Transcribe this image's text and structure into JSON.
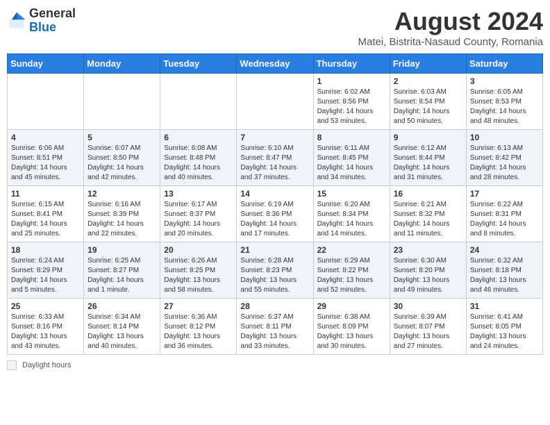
{
  "logo": {
    "general": "General",
    "blue": "Blue"
  },
  "title": "August 2024",
  "subtitle": "Matei, Bistrita-Nasaud County, Romania",
  "days_of_week": [
    "Sunday",
    "Monday",
    "Tuesday",
    "Wednesday",
    "Thursday",
    "Friday",
    "Saturday"
  ],
  "weeks": [
    [
      {
        "day": "",
        "info": ""
      },
      {
        "day": "",
        "info": ""
      },
      {
        "day": "",
        "info": ""
      },
      {
        "day": "",
        "info": ""
      },
      {
        "day": "1",
        "info": "Sunrise: 6:02 AM\nSunset: 8:56 PM\nDaylight: 14 hours\nand 53 minutes."
      },
      {
        "day": "2",
        "info": "Sunrise: 6:03 AM\nSunset: 8:54 PM\nDaylight: 14 hours\nand 50 minutes."
      },
      {
        "day": "3",
        "info": "Sunrise: 6:05 AM\nSunset: 8:53 PM\nDaylight: 14 hours\nand 48 minutes."
      }
    ],
    [
      {
        "day": "4",
        "info": "Sunrise: 6:06 AM\nSunset: 8:51 PM\nDaylight: 14 hours\nand 45 minutes."
      },
      {
        "day": "5",
        "info": "Sunrise: 6:07 AM\nSunset: 8:50 PM\nDaylight: 14 hours\nand 42 minutes."
      },
      {
        "day": "6",
        "info": "Sunrise: 6:08 AM\nSunset: 8:48 PM\nDaylight: 14 hours\nand 40 minutes."
      },
      {
        "day": "7",
        "info": "Sunrise: 6:10 AM\nSunset: 8:47 PM\nDaylight: 14 hours\nand 37 minutes."
      },
      {
        "day": "8",
        "info": "Sunrise: 6:11 AM\nSunset: 8:45 PM\nDaylight: 14 hours\nand 34 minutes."
      },
      {
        "day": "9",
        "info": "Sunrise: 6:12 AM\nSunset: 8:44 PM\nDaylight: 14 hours\nand 31 minutes."
      },
      {
        "day": "10",
        "info": "Sunrise: 6:13 AM\nSunset: 8:42 PM\nDaylight: 14 hours\nand 28 minutes."
      }
    ],
    [
      {
        "day": "11",
        "info": "Sunrise: 6:15 AM\nSunset: 8:41 PM\nDaylight: 14 hours\nand 25 minutes."
      },
      {
        "day": "12",
        "info": "Sunrise: 6:16 AM\nSunset: 8:39 PM\nDaylight: 14 hours\nand 22 minutes."
      },
      {
        "day": "13",
        "info": "Sunrise: 6:17 AM\nSunset: 8:37 PM\nDaylight: 14 hours\nand 20 minutes."
      },
      {
        "day": "14",
        "info": "Sunrise: 6:19 AM\nSunset: 8:36 PM\nDaylight: 14 hours\nand 17 minutes."
      },
      {
        "day": "15",
        "info": "Sunrise: 6:20 AM\nSunset: 8:34 PM\nDaylight: 14 hours\nand 14 minutes."
      },
      {
        "day": "16",
        "info": "Sunrise: 6:21 AM\nSunset: 8:32 PM\nDaylight: 14 hours\nand 11 minutes."
      },
      {
        "day": "17",
        "info": "Sunrise: 6:22 AM\nSunset: 8:31 PM\nDaylight: 14 hours\nand 8 minutes."
      }
    ],
    [
      {
        "day": "18",
        "info": "Sunrise: 6:24 AM\nSunset: 8:29 PM\nDaylight: 14 hours\nand 5 minutes."
      },
      {
        "day": "19",
        "info": "Sunrise: 6:25 AM\nSunset: 8:27 PM\nDaylight: 14 hours\nand 1 minute."
      },
      {
        "day": "20",
        "info": "Sunrise: 6:26 AM\nSunset: 8:25 PM\nDaylight: 13 hours\nand 58 minutes."
      },
      {
        "day": "21",
        "info": "Sunrise: 6:28 AM\nSunset: 8:23 PM\nDaylight: 13 hours\nand 55 minutes."
      },
      {
        "day": "22",
        "info": "Sunrise: 6:29 AM\nSunset: 8:22 PM\nDaylight: 13 hours\nand 52 minutes."
      },
      {
        "day": "23",
        "info": "Sunrise: 6:30 AM\nSunset: 8:20 PM\nDaylight: 13 hours\nand 49 minutes."
      },
      {
        "day": "24",
        "info": "Sunrise: 6:32 AM\nSunset: 8:18 PM\nDaylight: 13 hours\nand 46 minutes."
      }
    ],
    [
      {
        "day": "25",
        "info": "Sunrise: 6:33 AM\nSunset: 8:16 PM\nDaylight: 13 hours\nand 43 minutes."
      },
      {
        "day": "26",
        "info": "Sunrise: 6:34 AM\nSunset: 8:14 PM\nDaylight: 13 hours\nand 40 minutes."
      },
      {
        "day": "27",
        "info": "Sunrise: 6:36 AM\nSunset: 8:12 PM\nDaylight: 13 hours\nand 36 minutes."
      },
      {
        "day": "28",
        "info": "Sunrise: 6:37 AM\nSunset: 8:11 PM\nDaylight: 13 hours\nand 33 minutes."
      },
      {
        "day": "29",
        "info": "Sunrise: 6:38 AM\nSunset: 8:09 PM\nDaylight: 13 hours\nand 30 minutes."
      },
      {
        "day": "30",
        "info": "Sunrise: 6:39 AM\nSunset: 8:07 PM\nDaylight: 13 hours\nand 27 minutes."
      },
      {
        "day": "31",
        "info": "Sunrise: 6:41 AM\nSunset: 8:05 PM\nDaylight: 13 hours\nand 24 minutes."
      }
    ]
  ],
  "footer": {
    "legend_label": "Daylight hours"
  }
}
